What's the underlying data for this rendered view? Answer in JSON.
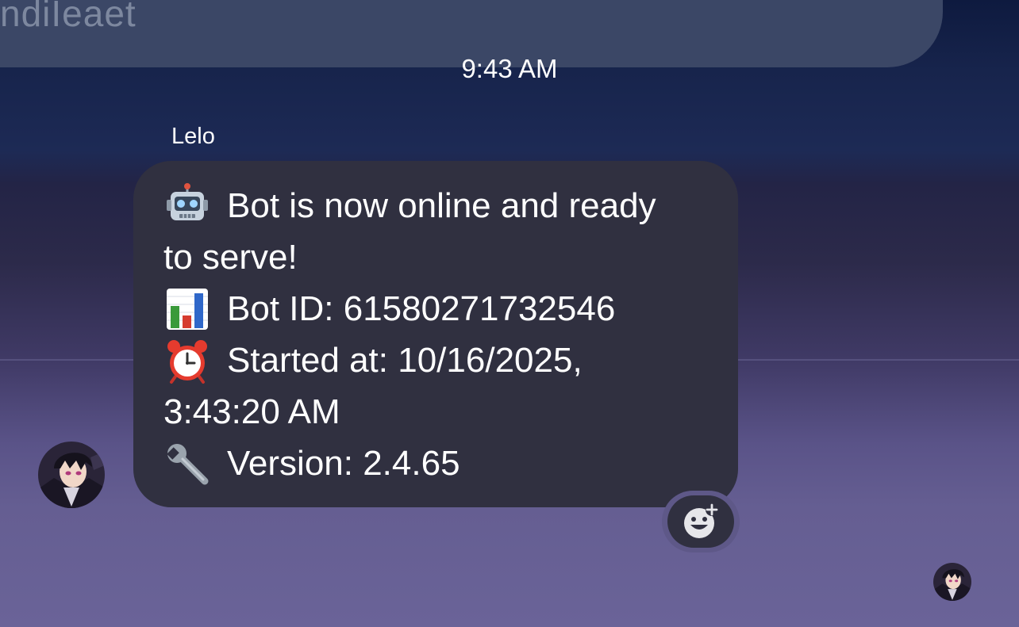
{
  "previous_message": {
    "partial_text": "ndiIeaet"
  },
  "timestamp": "9:43 AM",
  "message": {
    "sender": "Lelo",
    "lines": [
      {
        "icon": "robot-icon",
        "text": "Bot is now online and ready"
      },
      {
        "icon": "",
        "text": "to serve!"
      },
      {
        "icon": "bar-chart-icon",
        "text": "Bot ID: 61580271732546"
      },
      {
        "icon": "alarm-clock-icon",
        "text": "Started at: 10/16/2025,"
      },
      {
        "icon": "",
        "text": "3:43:20 AM"
      },
      {
        "icon": "wrench-icon",
        "text": "Version: 2.4.65"
      }
    ],
    "bubble_color": "#303040"
  },
  "reaction_button": {
    "icon": "add-reaction-icon"
  },
  "colors": {
    "background_top": "#0e1a3f",
    "background_bottom": "#6a6398",
    "text": "#ffffff"
  }
}
